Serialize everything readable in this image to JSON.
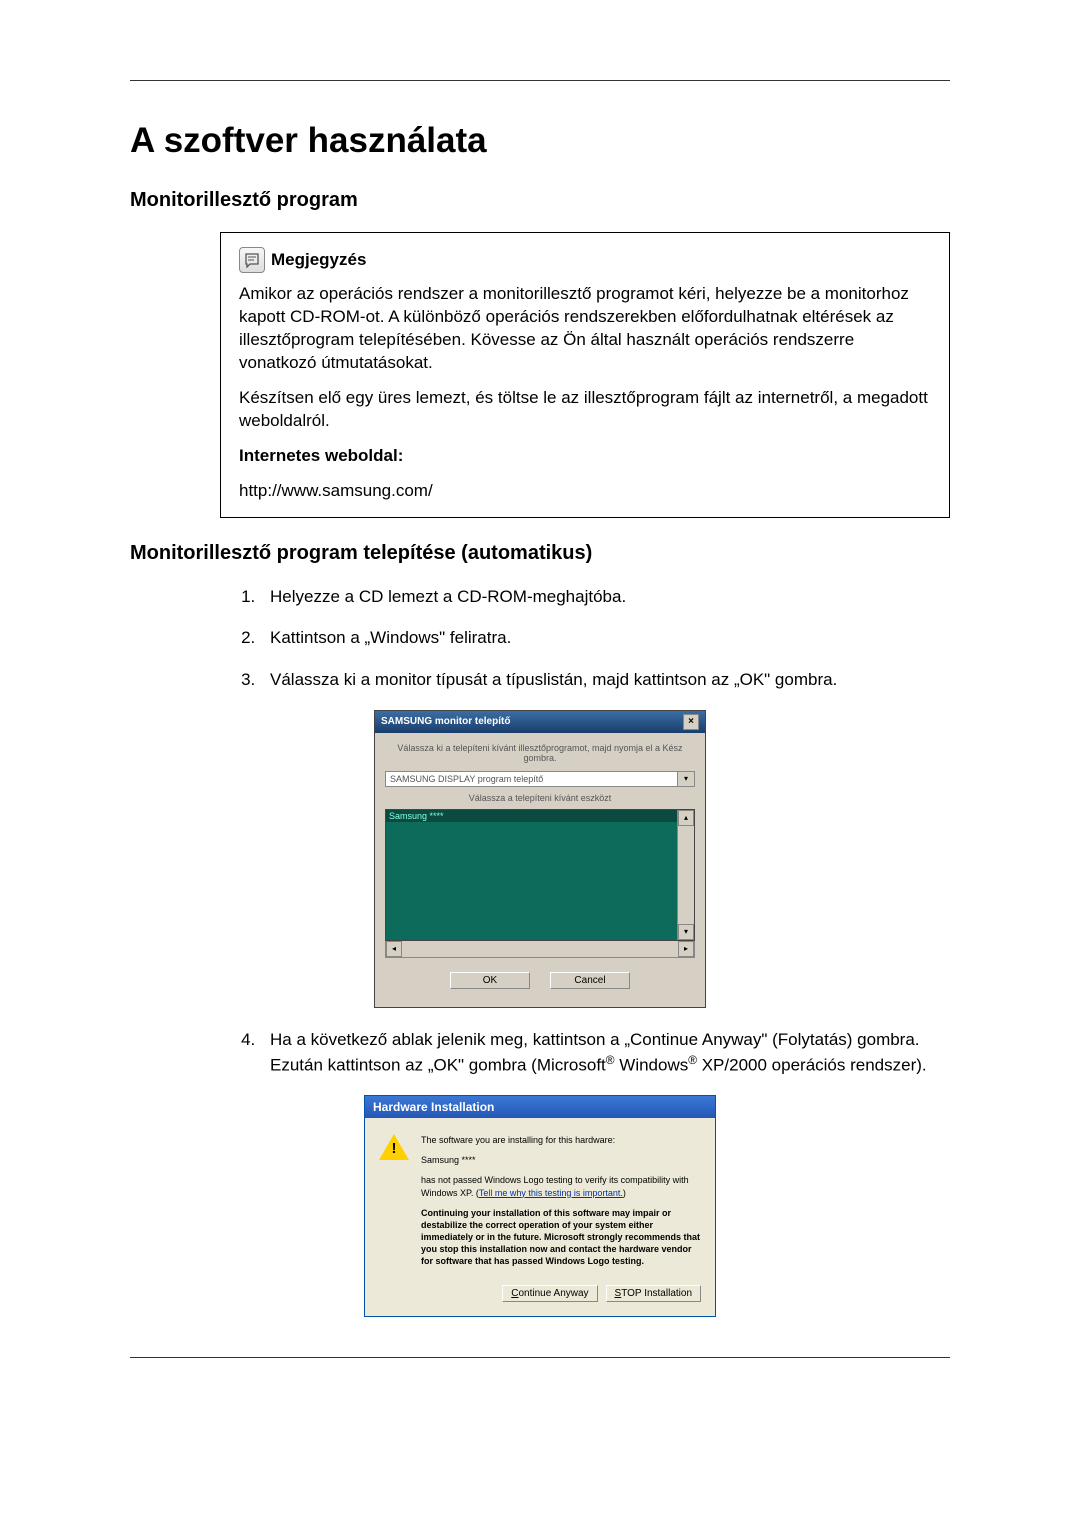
{
  "title": "A szoftver használata",
  "section1": {
    "heading": "Monitorillesztő program",
    "note_label": "Megjegyzés",
    "note_p1": "Amikor az operációs rendszer a monitorillesztő programot kéri, helyezze be a monitorhoz kapott CD-ROM-ot. A különböző operációs rendszerekben előfordulhatnak eltérések az illesztőprogram telepítésében. Kövesse az Ön által használt operációs rendszerre vonatkozó útmutatásokat.",
    "note_p2": "Készítsen elő egy üres lemezt, és töltse le az illesztőprogram fájlt az internetről, a megadott weboldalról.",
    "website_label": "Internetes weboldal:",
    "website_url": "http://www.samsung.com/"
  },
  "section2": {
    "heading": "Monitorillesztő program telepítése (automatikus)",
    "step1": "Helyezze a CD lemezt a CD-ROM-meghajtóba.",
    "step2": "Kattintson a „Windows\" feliratra.",
    "step3": "Válassza ki a monitor típusát a típuslistán, majd kattintson az „OK\" gombra.",
    "step4_a": "Ha a következő ablak jelenik meg, kattintson a „Continue Anyway\" (Folytatás) gombra. Ezután kattintson az „OK\" gombra (Microsoft",
    "step4_b": " Windows",
    "step4_c": " XP/2000 operációs rendszer).",
    "reg": "®"
  },
  "monitor_dialog": {
    "title": "SAMSUNG monitor telepítő",
    "text1": "Válassza ki a telepíteni kívánt illesztőprogramot, majd nyomja el a Kész gombra.",
    "combo": "SAMSUNG DISPLAY program telepítő",
    "text2": "Válassza a telepíteni kívánt eszközt",
    "list_sel": "Samsung ****",
    "ok": "OK",
    "cancel": "Cancel"
  },
  "hw_dialog": {
    "title": "Hardware Installation",
    "line1": "The software you are installing for this hardware:",
    "device": "Samsung ****",
    "line2a": "has not passed Windows Logo testing to verify its compatibility with Windows XP. (",
    "link": "Tell me why this testing is important.",
    "line2b": ")",
    "bold": "Continuing your installation of this software may impair or destabilize the correct operation of your system either immediately or in the future. Microsoft strongly recommends that you stop this installation now and contact the hardware vendor for software that has passed Windows Logo testing.",
    "continue": "Continue Anyway",
    "stop": "STOP Installation"
  }
}
